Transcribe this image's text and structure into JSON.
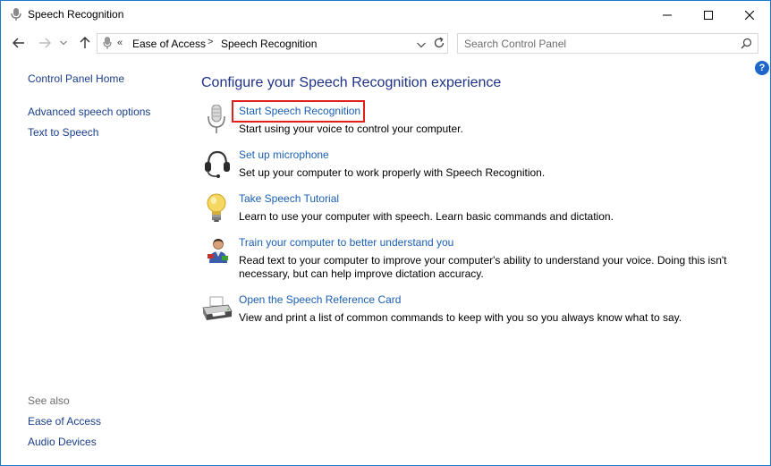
{
  "window": {
    "title": "Speech Recognition",
    "controls": {
      "minimize": "minimize",
      "maximize": "maximize",
      "close": "close"
    }
  },
  "address": {
    "overflow": "«",
    "crumbs": [
      "Ease of Access",
      "Speech Recognition"
    ],
    "separator": ">"
  },
  "search": {
    "placeholder": "Search Control Panel"
  },
  "help": {
    "label": "?"
  },
  "sidebar": {
    "home": "Control Panel Home",
    "items": [
      "Advanced speech options",
      "Text to Speech"
    ],
    "see_also_heading": "See also",
    "see_also": [
      "Ease of Access",
      "Audio Devices"
    ]
  },
  "main": {
    "title": "Configure your Speech Recognition experience",
    "tasks": [
      {
        "icon": "microphone-icon",
        "link": "Start Speech Recognition",
        "desc": "Start using your voice to control your computer."
      },
      {
        "icon": "headset-icon",
        "link": "Set up microphone",
        "desc": "Set up your computer to work properly with Speech Recognition."
      },
      {
        "icon": "lightbulb-icon",
        "link": "Take Speech Tutorial",
        "desc": "Learn to use your computer with speech.  Learn basic commands and dictation."
      },
      {
        "icon": "user-train-icon",
        "link": "Train your computer to better understand you",
        "desc": "Read text to your computer to improve your computer's ability to understand your voice.  Doing this isn't necessary, but can help improve dictation accuracy."
      },
      {
        "icon": "printer-icon",
        "link": "Open the Speech Reference Card",
        "desc": "View and print a list of common commands to keep with you so you always know what to say."
      }
    ]
  },
  "colors": {
    "link": "#1a5fb4",
    "sidebar_link": "#1a3e8c",
    "heading": "#1e3287",
    "highlight": "#e0201b",
    "window_border": "#1979ca"
  }
}
